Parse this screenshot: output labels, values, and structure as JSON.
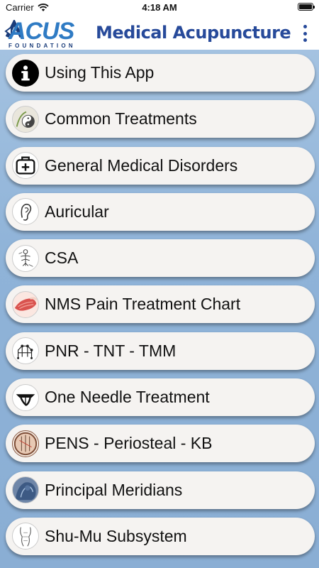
{
  "status_bar": {
    "carrier": "Carrier",
    "time": "4:18 AM",
    "battery_percent": 100
  },
  "header": {
    "logo_text": "ACUS",
    "logo_subtext": "FOUNDATION",
    "title": "Medical Acupuncture",
    "menu_icon": "kebab-menu-icon"
  },
  "menu": {
    "items": [
      {
        "label": "Using This App",
        "icon": "info-icon"
      },
      {
        "label": "Common Treatments",
        "icon": "yin-yang-icon"
      },
      {
        "label": "General Medical Disorders",
        "icon": "medical-bag-icon"
      },
      {
        "label": "Auricular",
        "icon": "ear-icon"
      },
      {
        "label": "CSA",
        "icon": "spine-figure-icon"
      },
      {
        "label": "NMS Pain Treatment Chart",
        "icon": "muscle-icon"
      },
      {
        "label": "PNR - TNT - TMM",
        "icon": "nerve-network-icon"
      },
      {
        "label": "One Needle Treatment",
        "icon": "needle-icon"
      },
      {
        "label": "PENS - Periosteal - KB",
        "icon": "electro-needles-icon"
      },
      {
        "label": "Principal Meridians",
        "icon": "meridian-body-icon"
      },
      {
        "label": "Shu-Mu Subsystem",
        "icon": "torso-outline-icon"
      }
    ]
  },
  "colors": {
    "background_top": "#a9c6e3",
    "background_bottom": "#8aaed4",
    "title_blue": "#274a9a",
    "logo_blue": "#2f7bc4",
    "button_fill": "#f5f3f1"
  }
}
